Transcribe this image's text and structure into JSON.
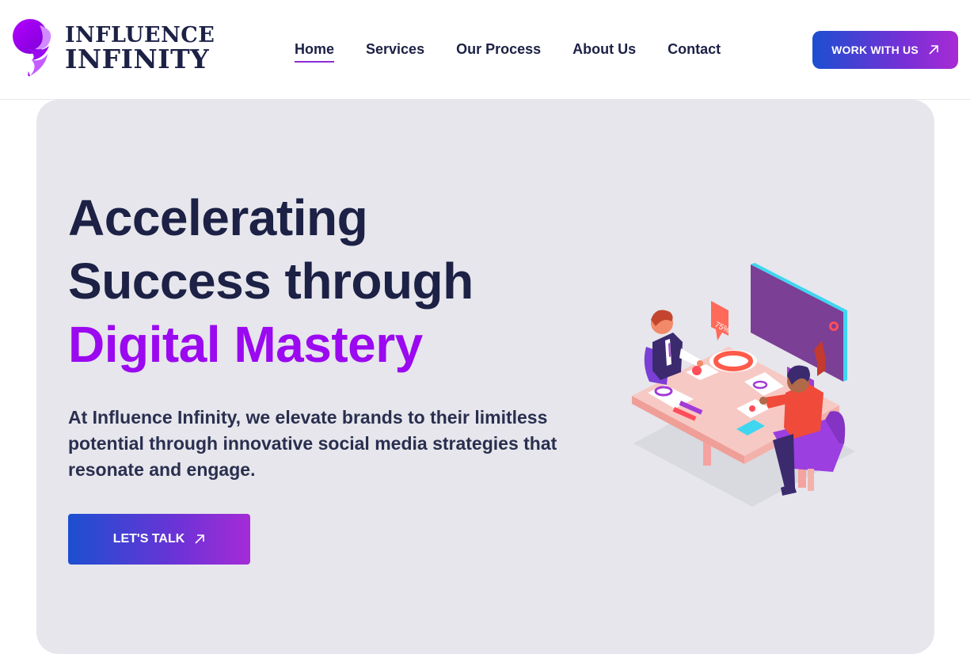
{
  "brand": {
    "line1": "INFLUENCE",
    "line2": "INFINITY",
    "colors": {
      "primary": "#9b09f0",
      "navy": "#1c2145"
    }
  },
  "nav": {
    "items": [
      {
        "label": "Home",
        "active": true
      },
      {
        "label": "Services",
        "active": false
      },
      {
        "label": "Our Process",
        "active": false
      },
      {
        "label": "About Us",
        "active": false
      },
      {
        "label": "Contact",
        "active": false
      }
    ]
  },
  "header": {
    "cta_label": "WORK WITH US",
    "cta_icon": "arrow-up-right-icon"
  },
  "hero": {
    "headline_line1": "Accelerating",
    "headline_line2": "Success through",
    "headline_accent": "Digital Mastery",
    "description": "At Influence Infinity, we elevate brands to their limitless potential through innovative social media strategies that resonate and engage.",
    "cta_label": "LET'S TALK",
    "cta_icon": "arrow-up-right-icon",
    "illustration": "team-meeting-illustration",
    "illustration_badge": "75%"
  }
}
